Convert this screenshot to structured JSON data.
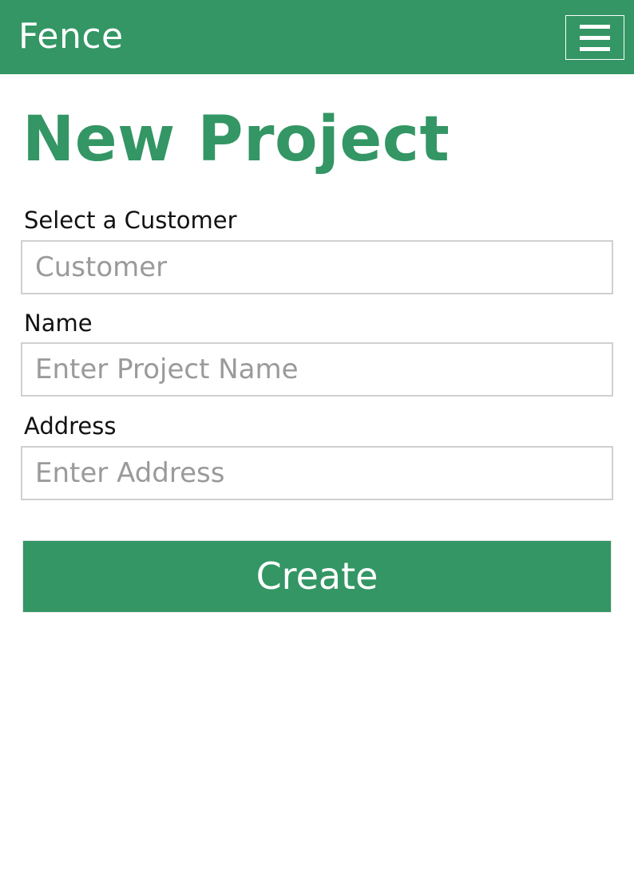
{
  "navbar": {
    "brand": "Fence",
    "menu_icon": "hamburger-menu-icon",
    "background_color": "#339664",
    "text_color": "#ffffff"
  },
  "page": {
    "title": "New Project",
    "accent_color": "#339664"
  },
  "form": {
    "customer": {
      "label": "Select a Customer",
      "value": "",
      "placeholder": "Customer"
    },
    "name": {
      "label": "Name",
      "value": "",
      "placeholder": "Enter Project Name"
    },
    "address": {
      "label": "Address",
      "value": "",
      "placeholder": "Enter Address"
    },
    "submit_label": "Create"
  }
}
